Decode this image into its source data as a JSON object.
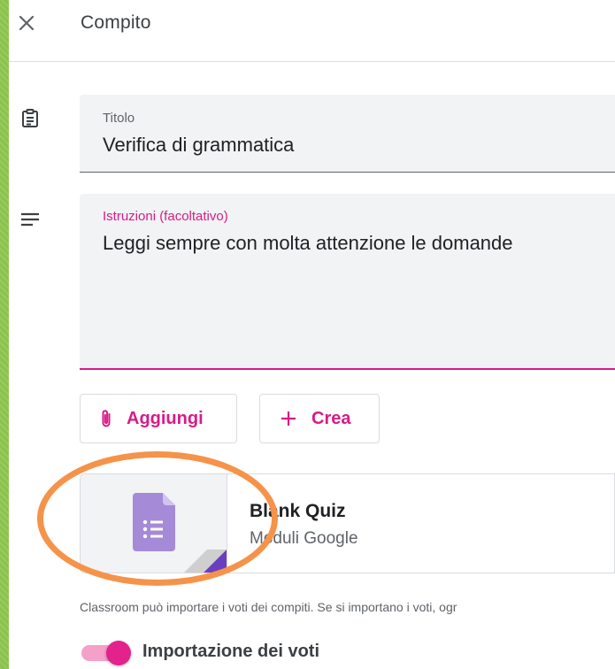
{
  "header": {
    "title": "Compito",
    "close_icon": "close-icon"
  },
  "title_field": {
    "icon": "assignment-icon",
    "label": "Titolo",
    "value": "Verifica di grammatica"
  },
  "instructions_field": {
    "icon": "notes-icon",
    "label": "Istruzioni (facoltativo)",
    "value": "Leggi sempre con molta attenzione le domande"
  },
  "actions": {
    "add_label": "Aggiungi",
    "add_icon": "paperclip-icon",
    "create_label": "Crea",
    "create_icon": "plus-icon"
  },
  "attachment": {
    "title": "Blank Quiz",
    "subtitle": "Moduli Google",
    "icon": "google-forms-icon"
  },
  "grade_import": {
    "note": "Classroom può importare i voti dei compiti. Se si importano i voti, ogr",
    "toggle_label": "Importazione dei voti",
    "enabled": true
  },
  "colors": {
    "accent": "#d81b86",
    "forms_purple": "#9c7fd6",
    "highlight": "#f5934a",
    "background": "#8bc34a"
  }
}
